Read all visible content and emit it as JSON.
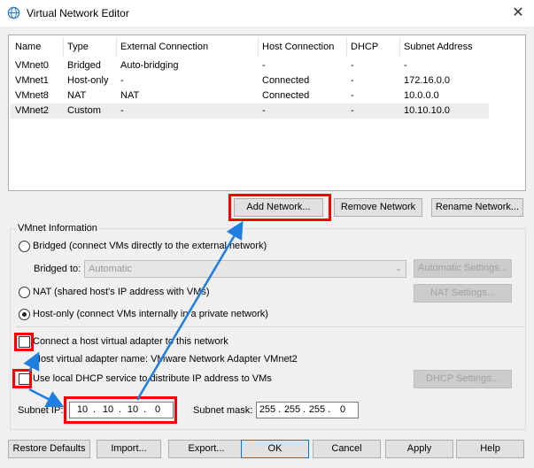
{
  "window": {
    "title": "Virtual Network Editor",
    "close_glyph": "✕",
    "icon": "globe-icon"
  },
  "network_list": {
    "columns": [
      "Name",
      "Type",
      "External Connection",
      "Host Connection",
      "DHCP",
      "Subnet Address"
    ],
    "rows": [
      [
        "VMnet0",
        "Bridged",
        "Auto-bridging",
        "-",
        "-",
        "-"
      ],
      [
        "VMnet1",
        "Host-only",
        "-",
        "Connected",
        "-",
        "172.16.0.0"
      ],
      [
        "VMnet8",
        "NAT",
        "NAT",
        "Connected",
        "-",
        "10.0.0.0"
      ],
      [
        "VMnet2",
        "Custom",
        "-",
        "-",
        "-",
        "10.10.10.0"
      ]
    ],
    "selected_row": "VMnet2"
  },
  "list_buttons": {
    "add": "Add Network...",
    "remove": "Remove Network",
    "rename": "Rename Network..."
  },
  "vmnet_info": {
    "group_title": "VMnet Information",
    "bridged_label": "Bridged (connect VMs directly to the external network)",
    "bridged_to_label": "Bridged to:",
    "bridged_to_value": "Automatic",
    "automatic_settings": "Automatic Settings...",
    "nat_label": "NAT (shared host's IP address with VMs)",
    "nat_settings": "NAT Settings...",
    "hostonly_label": "Host-only (connect VMs internally in a private network)",
    "selected_mode": "Host-only",
    "connect_adapter_label": "Connect a host virtual adapter to this network",
    "connect_adapter_checked": false,
    "adapter_name_text": "Host virtual adapter name: VMware Network Adapter VMnet2",
    "dhcp_label": "Use local DHCP service to distribute IP address to VMs",
    "dhcp_checked": false,
    "dhcp_settings": "DHCP Settings...",
    "subnet_ip_label": "Subnet IP:",
    "subnet_ip": [
      "10",
      "10",
      "10",
      "0"
    ],
    "subnet_mask_label": "Subnet mask:",
    "subnet_mask": [
      "255",
      "255",
      "255",
      "0"
    ]
  },
  "footer_buttons": {
    "restore": "Restore Defaults",
    "import": "Import...",
    "export": "Export...",
    "ok": "OK",
    "cancel": "Cancel",
    "apply": "Apply",
    "help": "Help"
  },
  "colors": {
    "highlight": "#ff0000",
    "arrow": "#1e7fe0"
  }
}
